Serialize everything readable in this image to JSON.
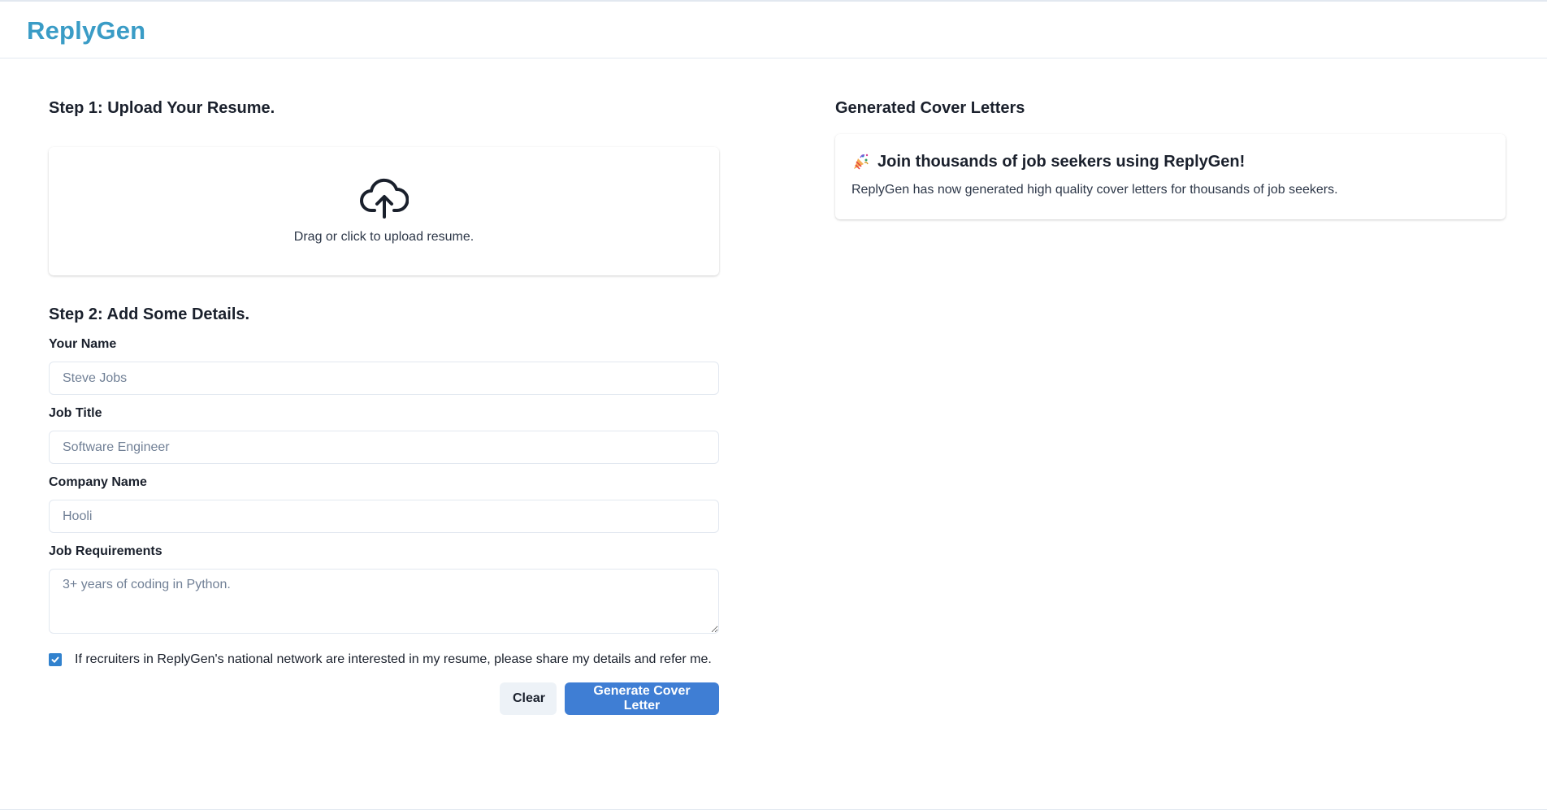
{
  "app": {
    "logo": "ReplyGen"
  },
  "step1": {
    "title": "Step 1: Upload Your Resume.",
    "upload_icon": "cloud-upload-icon",
    "upload_text": "Drag or click to upload resume."
  },
  "step2": {
    "title": "Step 2: Add Some Details.",
    "name_label": "Your Name",
    "name_placeholder": "Steve Jobs",
    "job_title_label": "Job Title",
    "job_title_placeholder": "Software Engineer",
    "company_label": "Company Name",
    "company_placeholder": "Hooli",
    "requirements_label": "Job Requirements",
    "requirements_placeholder": "3+ years of coding in Python.",
    "consent_checked": true,
    "consent_text": "If recruiters in ReplyGen's national network are interested in my resume, please share my details and refer me.",
    "clear_label": "Clear",
    "generate_label": "Generate Cover Letter"
  },
  "results": {
    "title": "Generated Cover Letters",
    "card_icon": "party-popper-icon",
    "card_title": "Join thousands of job seekers using ReplyGen!",
    "card_text": "ReplyGen has now generated high quality cover letters for thousands of job seekers."
  },
  "colors": {
    "brand": "#3a9cc6",
    "primary_button": "#3f7ed4",
    "checkbox": "#3182ce"
  }
}
